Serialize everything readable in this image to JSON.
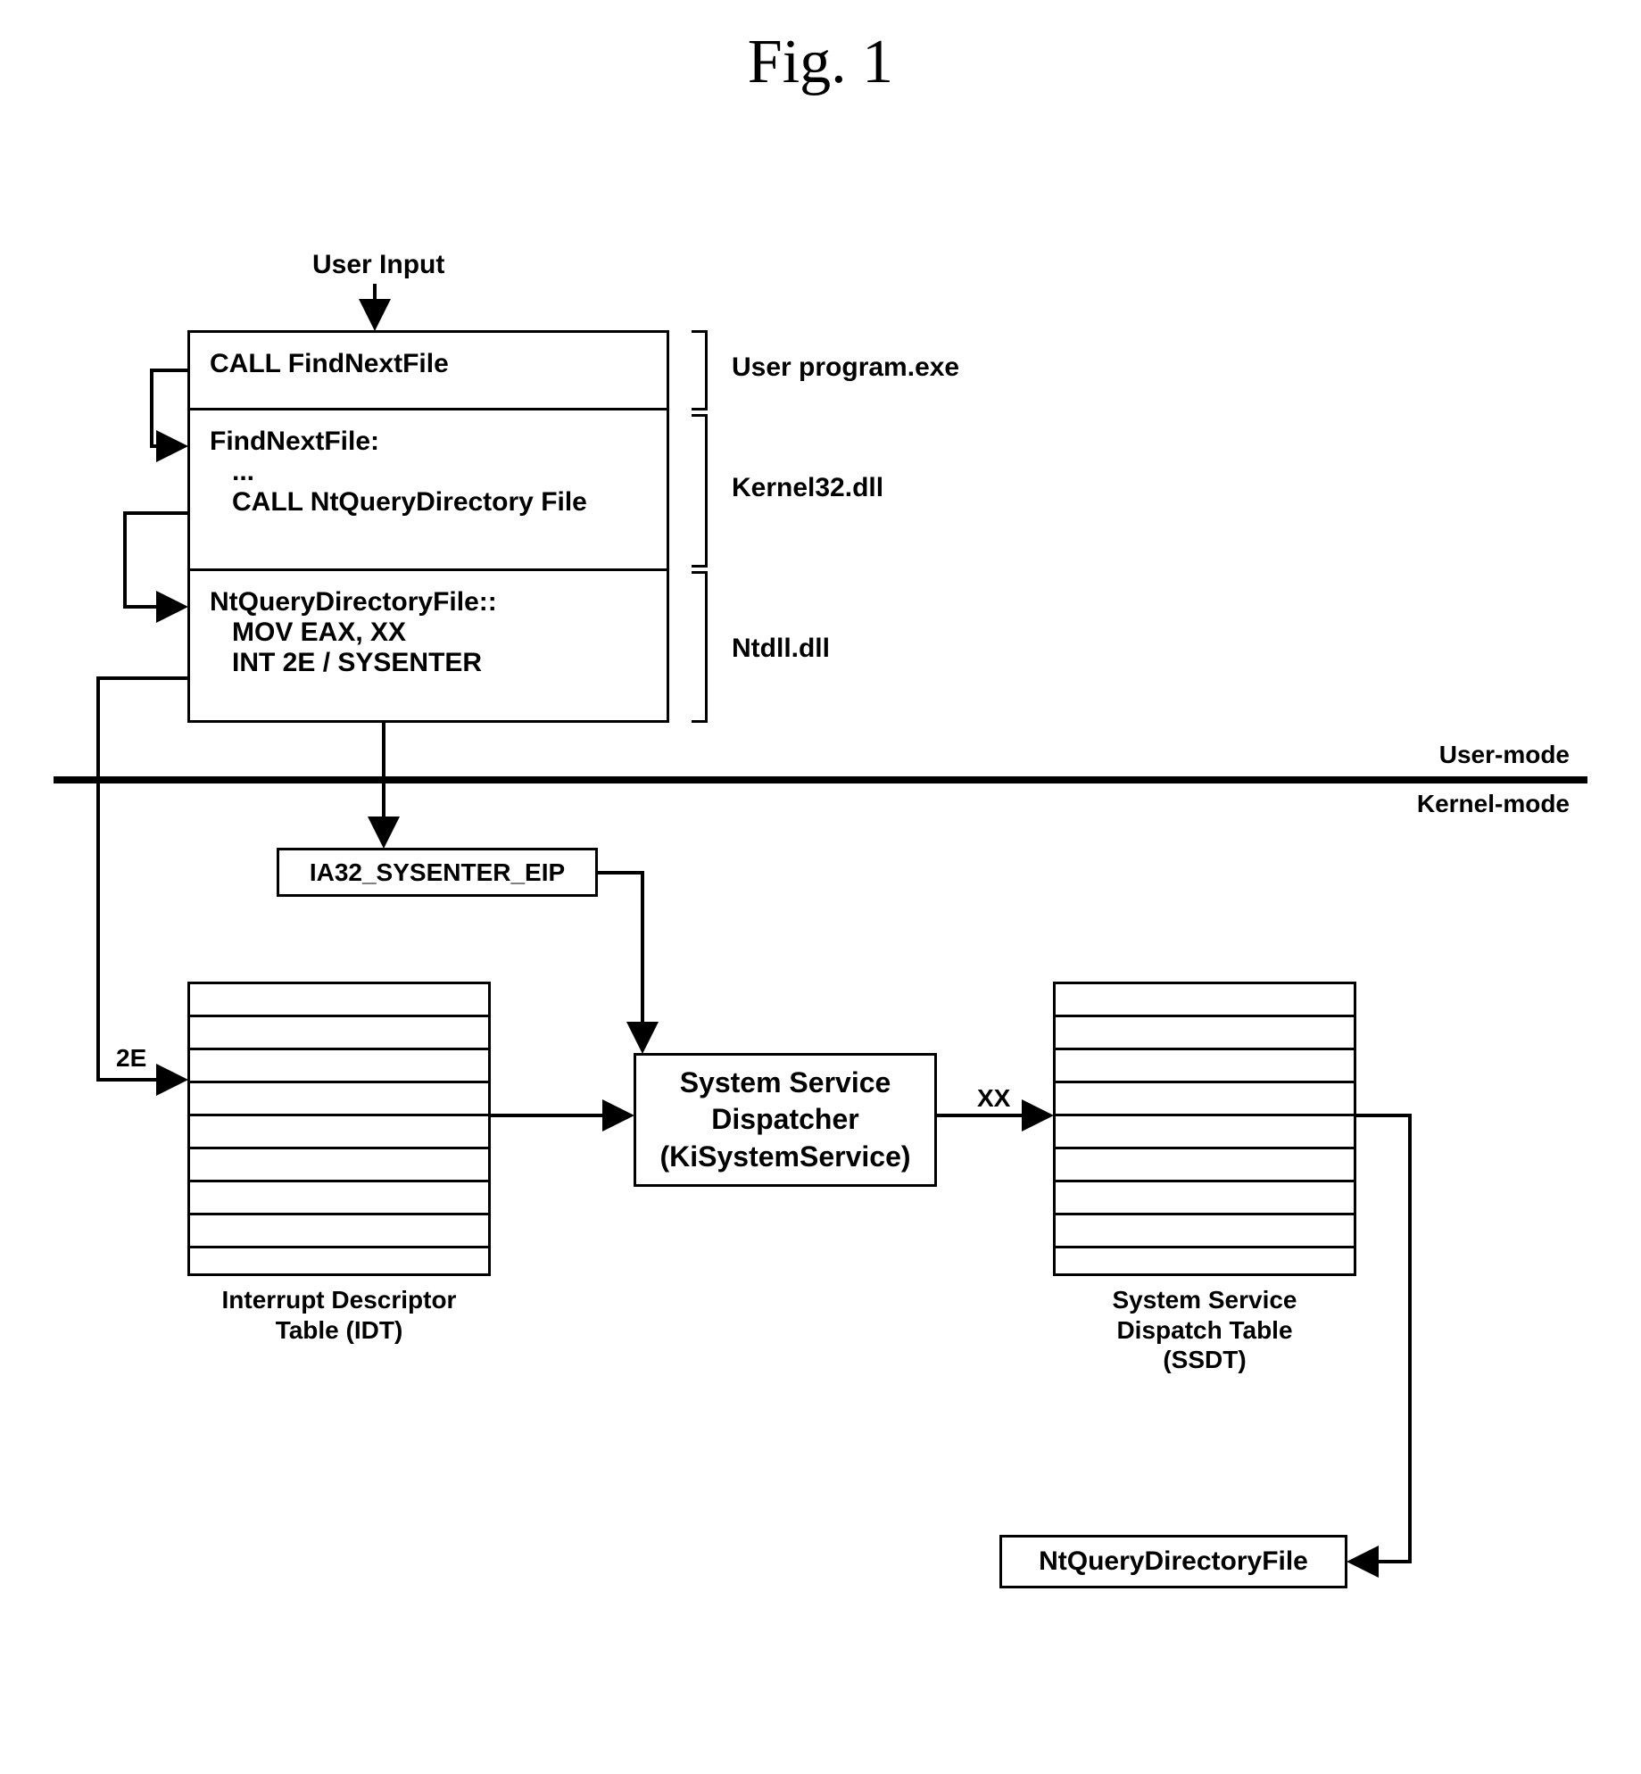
{
  "figure_title": "Fig. 1",
  "input_label": "User Input",
  "stack": {
    "row1": {
      "text": "CALL FindNextFile",
      "bracket_label": "User program.exe"
    },
    "row2": {
      "line1": "FindNextFile:",
      "line2": "   ...",
      "line3": "   CALL NtQueryDirectory File",
      "bracket_label": "Kernel32.dll"
    },
    "row3": {
      "line1": "NtQueryDirectoryFile::",
      "line2": "   MOV EAX, XX",
      "line3": "   INT 2E / SYSENTER",
      "bracket_label": "Ntdll.dll"
    }
  },
  "mode_labels": {
    "user": "User-mode",
    "kernel": "Kernel-mode"
  },
  "sysenter_box": "IA32_SYSENTER_EIP",
  "idt_caption": "Interrupt Descriptor\nTable (IDT)",
  "dispatcher": "System Service\nDispatcher\n(KiSystemService)",
  "ssdt_caption": "System Service\nDispatch Table\n(SSDT)",
  "final_box": "NtQueryDirectoryFile",
  "edge_labels": {
    "int2e": "2E",
    "xx": "XX"
  }
}
